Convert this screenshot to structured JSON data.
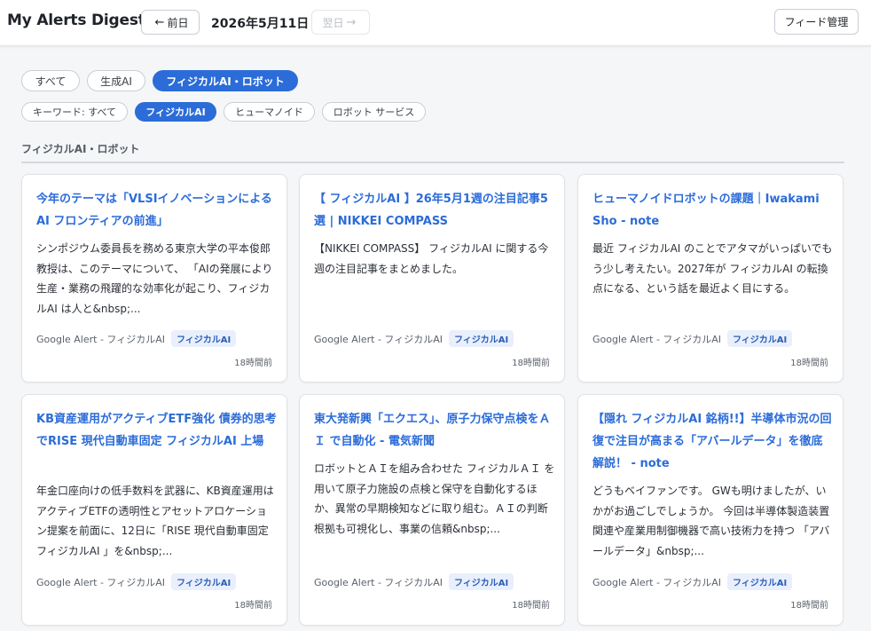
{
  "header": {
    "title": "My Alerts Digest",
    "prev_label": "前日",
    "date": "2026年5月11日",
    "next_label": "翌日",
    "feed_button": "フィード管理"
  },
  "category_filters": [
    {
      "label": "すべて",
      "active": false
    },
    {
      "label": "生成AI",
      "active": false
    },
    {
      "label": "フィジカルAI・ロボット",
      "active": true
    }
  ],
  "keyword_filters": [
    {
      "label": "キーワード: すべて",
      "active": false
    },
    {
      "label": "フィジカルAI",
      "active": true
    },
    {
      "label": "ヒューマノイド",
      "active": false
    },
    {
      "label": "ロボット サービス",
      "active": false
    }
  ],
  "section": {
    "title": "フィジカルAI・ロボット"
  },
  "cards": [
    {
      "title": "今年のテーマは「VLSIイノベーションによる AI フロンティアの前進」",
      "body": "シンポジウム委員長を務める東京大学の平本俊郎 教授は、このテーマについて、 「AIの発展により生産・業務の飛躍的な効率化が起こり、フィジカルAI は人と&nbsp;...",
      "source": "Google Alert - フィジカルAI",
      "tag": "フィジカルAI",
      "time": "18時間前"
    },
    {
      "title": "【 フィジカルAI 】26年5月1週の注目記事5選 | NIKKEI COMPASS",
      "body": "【NIKKEI COMPASS】 フィジカルAI に関する今週の注目記事をまとめました。",
      "source": "Google Alert - フィジカルAI",
      "tag": "フィジカルAI",
      "time": "18時間前"
    },
    {
      "title": "ヒューマノイドロボットの課題｜Iwakami Sho - note",
      "body": "最近 フィジカルAI のことでアタマがいっぱいでもう少し考えたい。2027年が フィジカルAI の転換点になる、という話を最近よく目にする。",
      "source": "Google Alert - フィジカルAI",
      "tag": "フィジカルAI",
      "time": "18時間前"
    },
    {
      "title": "KB資産運用がアクティブETF強化 債券的思考でRISE 現代自動車固定 フィジカルAI 上場",
      "body": "年金口座向けの低手数料を武器に、KB資産運用はアクティブETFの透明性とアセットアロケーション提案を前面に、12日に「RISE 現代自動車固定 フィジカルAI 」を&nbsp;...",
      "source": "Google Alert - フィジカルAI",
      "tag": "フィジカルAI",
      "time": "18時間前"
    },
    {
      "title": "東大発新興「エクエス」、原子力保守点検をＡＩ で自動化 - 電気新聞",
      "body": "ロボットとＡＩを組み合わせた フィジカルＡＩ を用いて原子力施設の点検と保守を自動化するほか、異常の早期検知などに取り組む。ＡＩの判断根拠も可視化し、事業の信頼&nbsp;...",
      "source": "Google Alert - フィジカルAI",
      "tag": "フィジカルAI",
      "time": "18時間前"
    },
    {
      "title": "【隠れ フィジカルAI 銘柄!!】半導体市況の回復で注目が高まる「アバールデータ」を徹底解説！ - note",
      "body": "どうもベイファンです。 GWも明けましたが、いかがお過ごしでしょうか。 今回は半導体製造装置関連や産業用制御機器で高い技術力を持つ 「アバールデータ」&nbsp;...",
      "source": "Google Alert - フィジカルAI",
      "tag": "フィジカルAI",
      "time": "18時間前"
    }
  ]
}
